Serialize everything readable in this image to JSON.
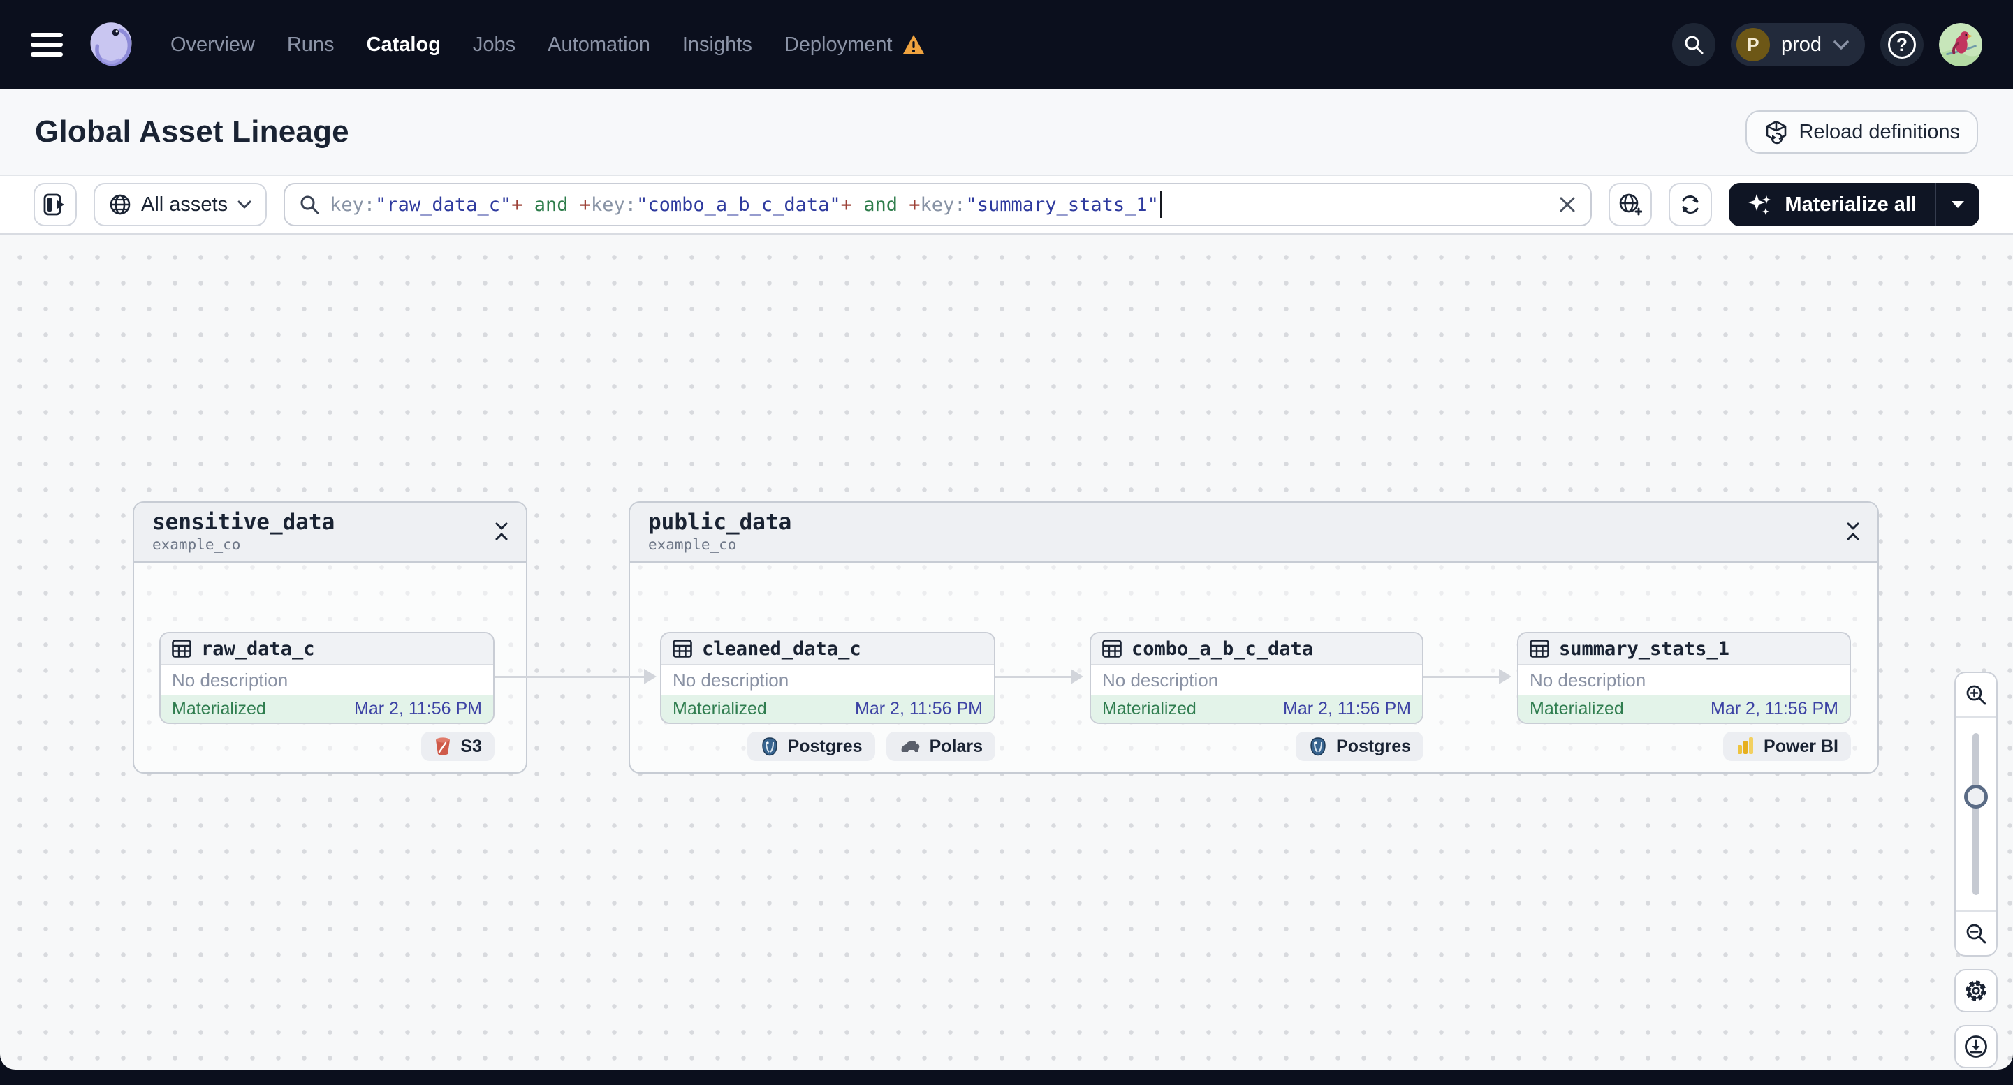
{
  "navbar": {
    "logo": "dagster-logo",
    "items": [
      {
        "label": "Overview",
        "active": false
      },
      {
        "label": "Runs",
        "active": false
      },
      {
        "label": "Catalog",
        "active": true
      },
      {
        "label": "Jobs",
        "active": false
      },
      {
        "label": "Automation",
        "active": false
      },
      {
        "label": "Insights",
        "active": false
      },
      {
        "label": "Deployment",
        "active": false,
        "warning": true
      }
    ],
    "environment": {
      "initial": "P",
      "name": "prod"
    }
  },
  "header": {
    "title": "Global Asset Lineage",
    "reload_button_label": "Reload definitions"
  },
  "toolbar": {
    "scope_label": "All assets",
    "materialize_label": "Materialize all",
    "syntax_colors": {
      "field": "#8893a5",
      "string": "#2e3a9e",
      "operator": "#9c4036",
      "keyword": "#2e7d4b"
    },
    "query": {
      "segments": [
        {
          "text": "key:",
          "color": "#8893a5"
        },
        {
          "text": "\"raw_data_c\"",
          "color": "#2e3a9e"
        },
        {
          "text": "+",
          "color": "#9c4036"
        },
        {
          "text": " and ",
          "color": "#2e7d4b"
        },
        {
          "text": "+",
          "color": "#9c4036"
        },
        {
          "text": "key:",
          "color": "#8893a5"
        },
        {
          "text": "\"combo_a_b_c_data\"",
          "color": "#2e3a9e"
        },
        {
          "text": "+",
          "color": "#9c4036"
        },
        {
          "text": " and ",
          "color": "#2e7d4b"
        },
        {
          "text": "+",
          "color": "#9c4036"
        },
        {
          "text": "key:",
          "color": "#8893a5"
        },
        {
          "text": "\"summary_stats_1\"",
          "color": "#2e3a9e"
        }
      ]
    }
  },
  "graph": {
    "groups": [
      {
        "name": "sensitive_data",
        "location": "example_co"
      },
      {
        "name": "public_data",
        "location": "example_co"
      }
    ],
    "assets": [
      {
        "name": "raw_data_c",
        "description": "No description",
        "status": "Materialized",
        "timestamp": "Mar 2, 11:56 PM",
        "tags": [
          {
            "label": "S3",
            "icon": "s3-bucket-icon"
          }
        ]
      },
      {
        "name": "cleaned_data_c",
        "description": "No description",
        "status": "Materialized",
        "timestamp": "Mar 2, 11:56 PM",
        "tags": [
          {
            "label": "Postgres",
            "icon": "postgres-icon"
          },
          {
            "label": "Polars",
            "icon": "polars-icon"
          }
        ]
      },
      {
        "name": "combo_a_b_c_data",
        "description": "No description",
        "status": "Materialized",
        "timestamp": "Mar 2, 11:56 PM",
        "tags": [
          {
            "label": "Postgres",
            "icon": "postgres-icon"
          }
        ]
      },
      {
        "name": "summary_stats_1",
        "description": "No description",
        "status": "Materialized",
        "timestamp": "Mar 2, 11:56 PM",
        "tags": [
          {
            "label": "Power BI",
            "icon": "powerbi-icon"
          }
        ]
      }
    ],
    "status_colors": {
      "materialized_bg": "#e3f3e9",
      "materialized_text": "#2f7d4f",
      "timestamp_text": "#3c42a4"
    }
  }
}
